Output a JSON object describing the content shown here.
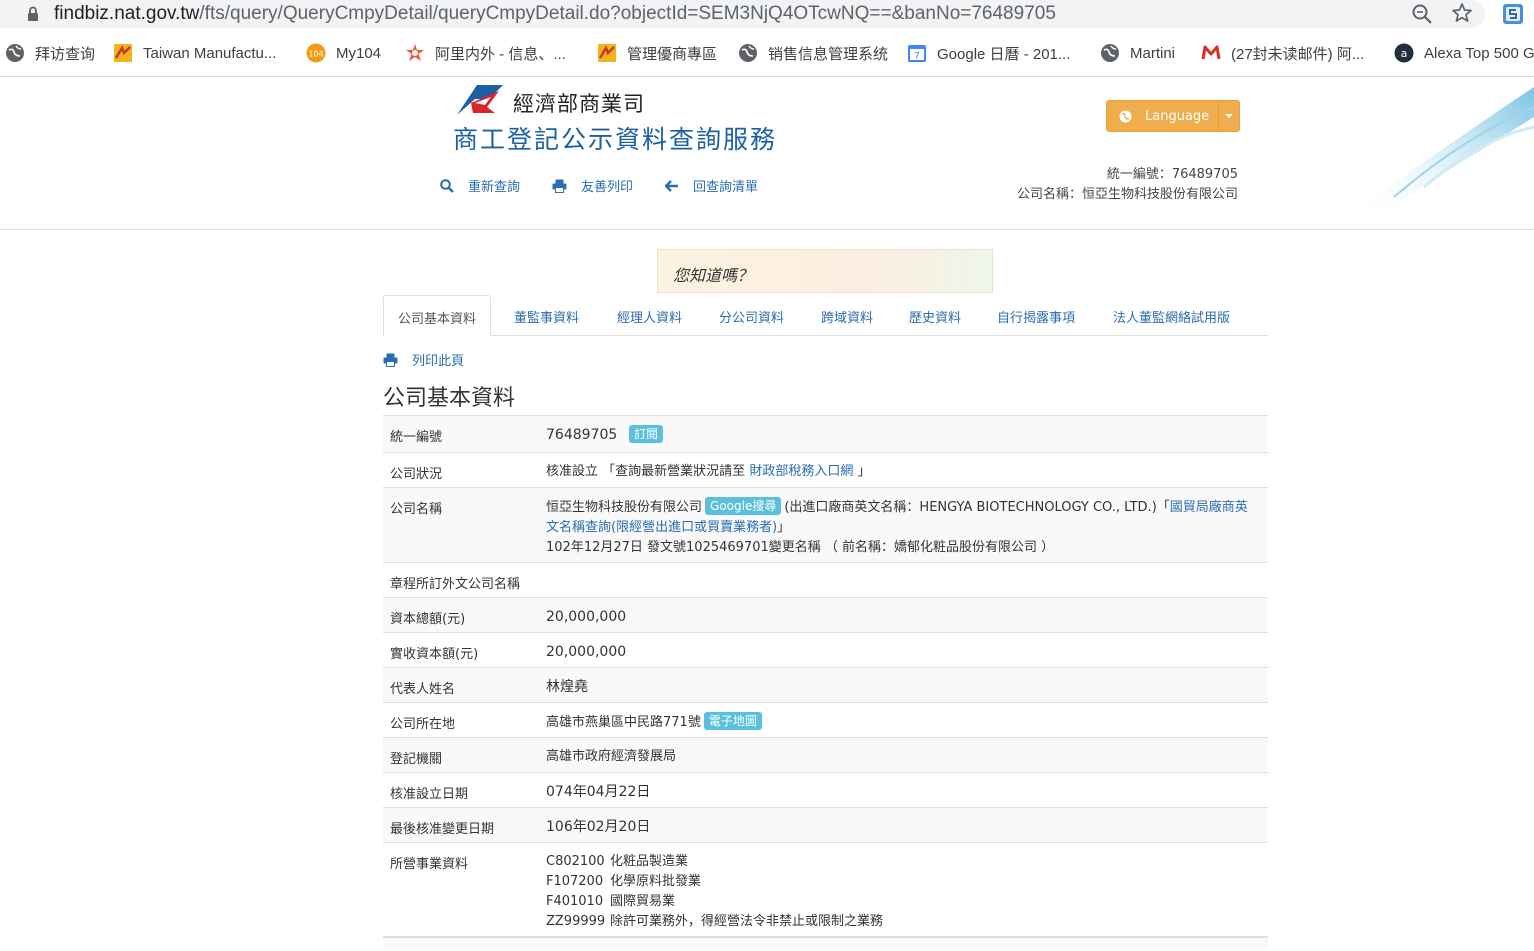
{
  "browser": {
    "url_host": "findbiz.nat.gov.tw",
    "url_path": "/fts/query/QueryCmpyDetail/queryCmpyDetail.do?objectId=SEM3NjQ4OTcwNQ==&banNo=76489705",
    "bookmarks": [
      {
        "label": "拜访查询",
        "icon": "globe-icon"
      },
      {
        "label": "Taiwan Manufactu...",
        "icon": "site-icon"
      },
      {
        "label": "My104",
        "icon": "my104-icon"
      },
      {
        "label": "阿里内外 - 信息、...",
        "icon": "alibaba-icon"
      },
      {
        "label": "管理優商專區",
        "icon": "site-icon"
      },
      {
        "label": "销售信息管理系统",
        "icon": "globe-icon"
      },
      {
        "label": "Google 日曆 - 201...",
        "icon": "calendar-icon"
      },
      {
        "label": "Martini",
        "icon": "globe-icon"
      },
      {
        "label": "(27封未读邮件) 阿...",
        "icon": "mail-icon"
      },
      {
        "label": "Alexa Top 500 G",
        "icon": "alexa-icon"
      }
    ]
  },
  "header": {
    "ministry": "經濟部商業司",
    "service_title": "商工登記公示資料查詢服務",
    "nav": {
      "requery": "重新查詢",
      "print": "友善列印",
      "back": "回查詢清單"
    },
    "language_label": "Language",
    "ban_no_line": "統一編號：76489705",
    "company_line": "公司名稱：恒亞生物科技股份有限公司"
  },
  "did_you_know": "您知道嗎？",
  "tabs": [
    "公司基本資料",
    "董監事資料",
    "經理人資料",
    "分公司資料",
    "跨域資料",
    "歷史資料",
    "自行揭露事項",
    "法人董監網絡試用版"
  ],
  "print_page_label": "列印此頁",
  "section_title": "公司基本資料",
  "fields": {
    "ban_no": {
      "label": "統一編號",
      "value": "76489705",
      "badge": "訂閱"
    },
    "status": {
      "label": "公司狀況",
      "value": "核准設立",
      "pre": "「查詢最新營業狀況請至",
      "link": "財政部稅務入口網",
      "post": "」"
    },
    "name": {
      "label": "公司名稱",
      "value": "恒亞生物科技股份有限公司",
      "badge": "Google搜尋",
      "en_name": "(出進口廠商英文名稱：HENGYA BIOTECHNOLOGY CO., LTD.)",
      "bracket": "「",
      "link": "國貿局廠商英文名稱查詢(限經營出進口或買賣業務者)",
      "link_end": "」",
      "change": "102年12月27日 發文號1025469701變更名稱 （ 前名稱：嬌郁化粧品股份有限公司 ）"
    },
    "foreign_name": {
      "label": "章程所訂外文公司名稱",
      "value": ""
    },
    "capital": {
      "label": "資本總額(元)",
      "value": "20,000,000"
    },
    "paid_capital": {
      "label": "實收資本額(元)",
      "value": "20,000,000"
    },
    "representative": {
      "label": "代表人姓名",
      "value": "林煌堯"
    },
    "address": {
      "label": "公司所在地",
      "value": "高雄市燕巢區中民路771號",
      "badge": "電子地圖"
    },
    "authority": {
      "label": "登記機關",
      "value": "高雄市政府經濟發展局"
    },
    "setup_date": {
      "label": "核准設立日期",
      "value": "074年04月22日"
    },
    "change_date": {
      "label": "最後核准變更日期",
      "value": "106年02月20日"
    },
    "business": {
      "label": "所營事業資料",
      "items": [
        {
          "code": "C802100",
          "desc": "化粧品製造業"
        },
        {
          "code": "F107200",
          "desc": "化學原料批發業"
        },
        {
          "code": "F401010",
          "desc": "國際貿易業"
        },
        {
          "code": "ZZ99999",
          "desc": "除許可業務外，得經營法令非禁止或限制之業務"
        }
      ]
    }
  },
  "colors": {
    "link": "#2a6db0",
    "badge": "#5bc0de",
    "language_button": "#f0ad4e",
    "title_blue": "#1b5fa5"
  }
}
